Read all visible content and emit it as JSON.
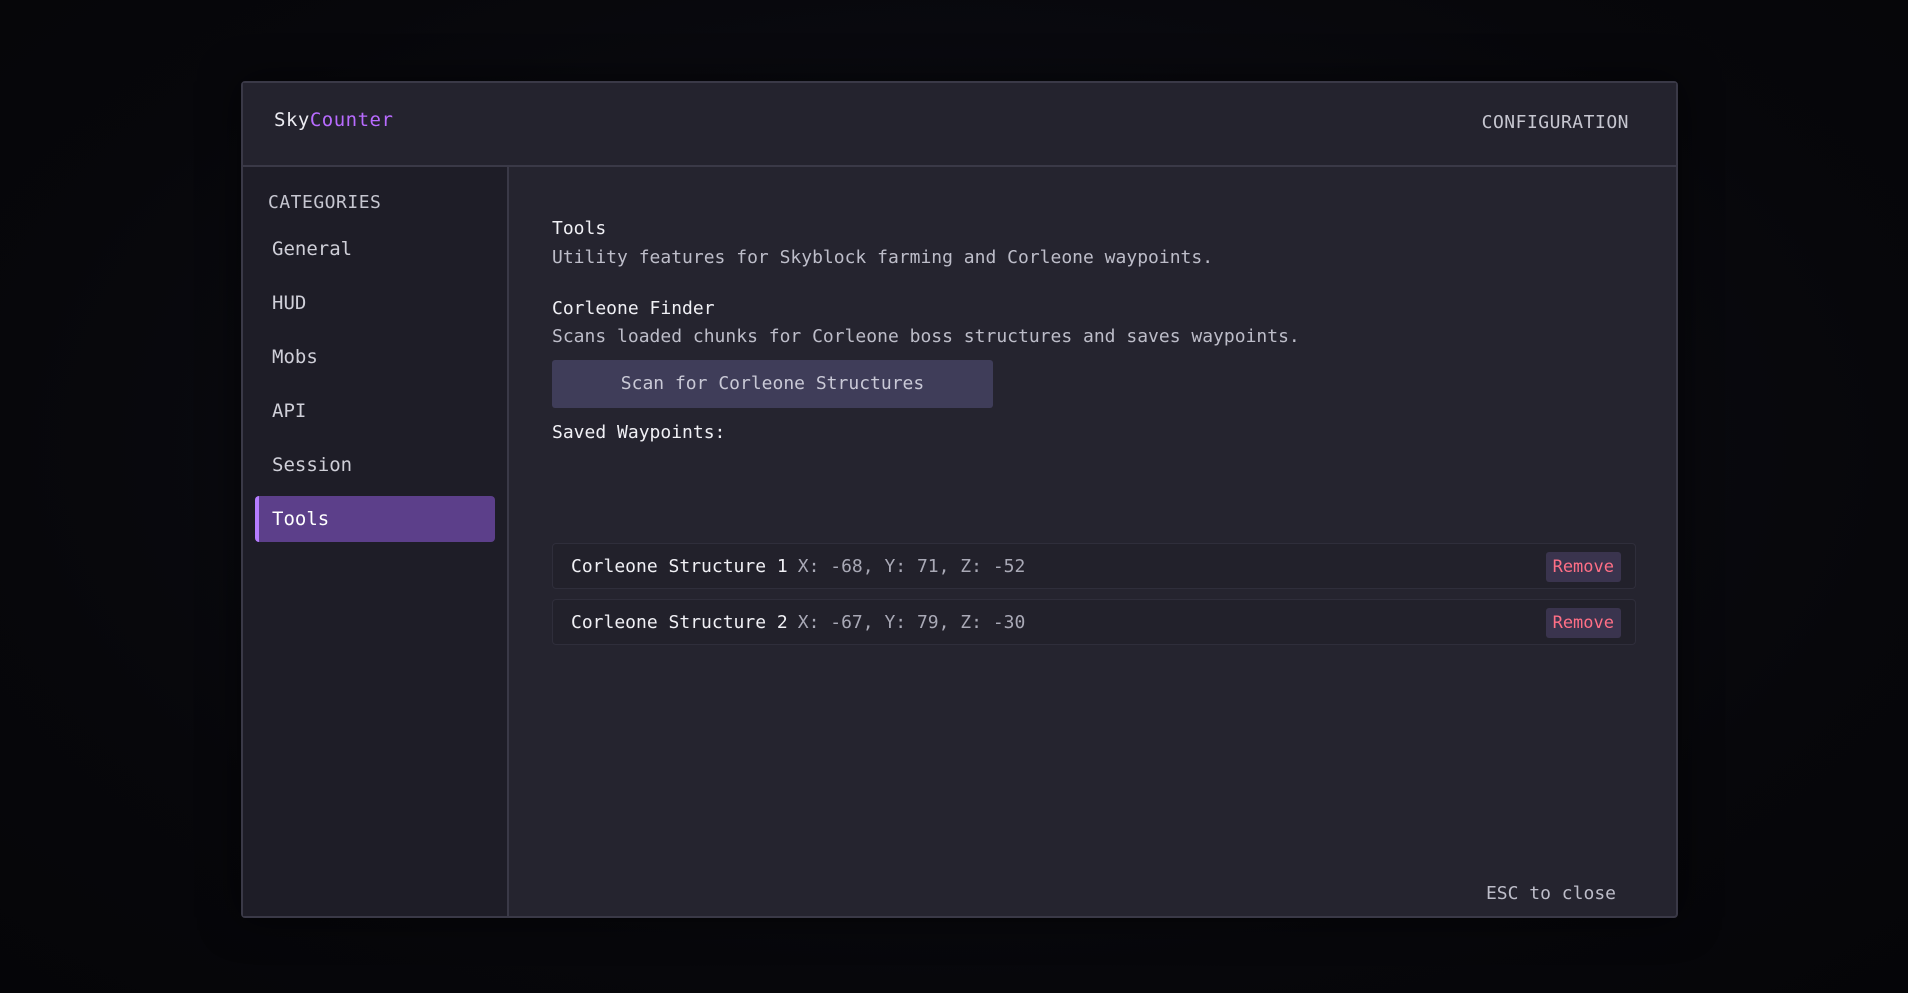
{
  "header": {
    "brand_part1": "Sky",
    "brand_part2": "Counter",
    "right_label": "CONFIGURATION"
  },
  "sidebar": {
    "heading": "CATEGORIES",
    "items": [
      {
        "label": "General",
        "active": false
      },
      {
        "label": "HUD",
        "active": false
      },
      {
        "label": "Mobs",
        "active": false
      },
      {
        "label": "API",
        "active": false
      },
      {
        "label": "Session",
        "active": false
      },
      {
        "label": "Tools",
        "active": true
      }
    ]
  },
  "main": {
    "section_title": "Tools",
    "section_description": "Utility features for Skyblock farming and Corleone waypoints.",
    "finder_title": "Corleone Finder",
    "finder_description": "Scans loaded chunks for Corleone boss structures and saves waypoints.",
    "scan_button_label": "Scan for Corleone Structures",
    "saved_label": "Saved Waypoints:",
    "waypoints": [
      {
        "name": "Corleone Structure 1",
        "coords": "X: -68, Y: 71, Z: -52",
        "remove_label": "Remove"
      },
      {
        "name": "Corleone Structure 2",
        "coords": "X: -67, Y: 79, Z: -30",
        "remove_label": "Remove"
      }
    ]
  },
  "footer": {
    "esc_hint": "ESC to close"
  },
  "colors": {
    "accent": "#b86bff",
    "active_item_bg": "#5c3f8a",
    "remove_text": "#ff6f86",
    "panel_bg": "#25242f"
  }
}
